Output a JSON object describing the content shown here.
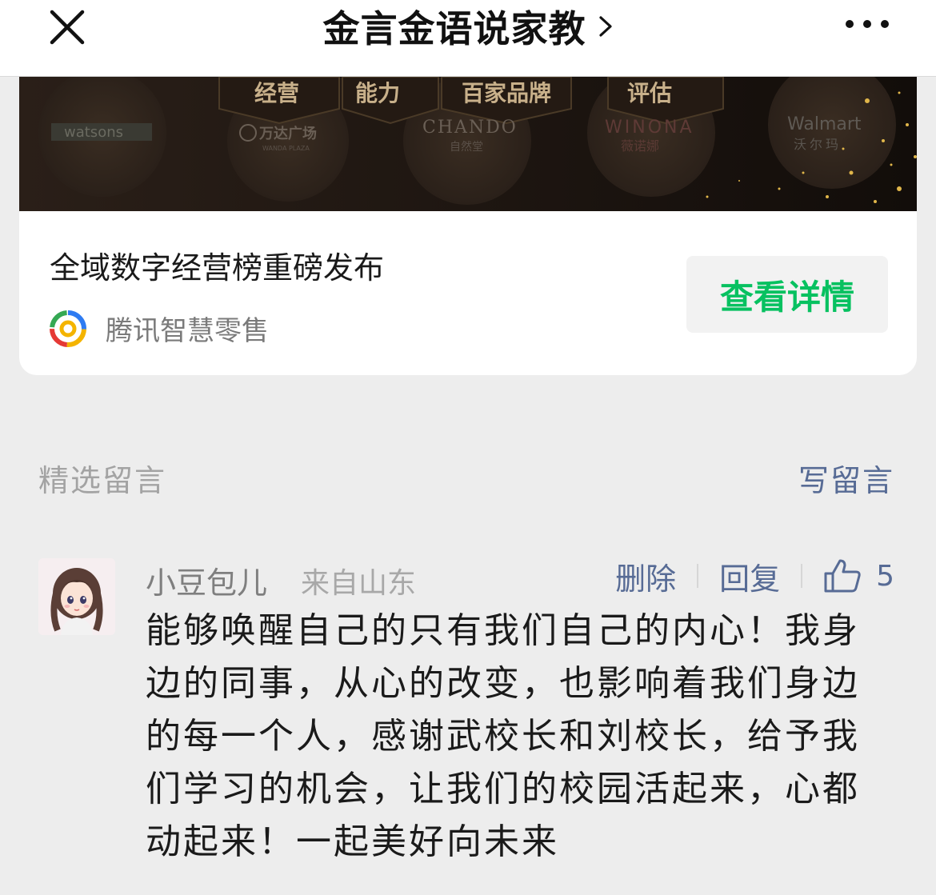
{
  "header": {
    "title": "金言金语说家教"
  },
  "icons": {
    "close": "close-icon",
    "title_arrow": "chevron-right-icon",
    "more": "more-dots-icon",
    "source_logo": "tencent-smart-retail-logo-icon",
    "like": "thumbs-up-icon"
  },
  "ad": {
    "banner": {
      "tabs": [
        "经营",
        "能力",
        "百家品牌",
        "评估"
      ],
      "brands": [
        "watsons",
        "万达广场",
        "WANDA PLAZA",
        "CHANDO",
        "自然堂",
        "WINONA",
        "薇诺娜",
        "Walmart",
        "沃尔玛"
      ]
    },
    "title": "全域数字经营榜重磅发布",
    "source": "腾讯智慧零售",
    "cta": "查看详情"
  },
  "comments_section": {
    "title": "精选留言",
    "write_label": "写留言",
    "items": [
      {
        "nickname": "小豆包儿",
        "location": "来自山东",
        "delete_label": "删除",
        "reply_label": "回复",
        "likes": "5",
        "text": "能够唤醒自己的只有我们自己的内心！我身边的同事，从心的改变，也影响着我们身边的每一个人，感谢武校长和刘校长，给予我们学习的机会，让我们的校园活起来，心都动起来！一起美好向未来"
      }
    ]
  },
  "colors": {
    "accent_green": "#07c160",
    "link_blue": "#576b95",
    "page_bg": "#ededed"
  }
}
